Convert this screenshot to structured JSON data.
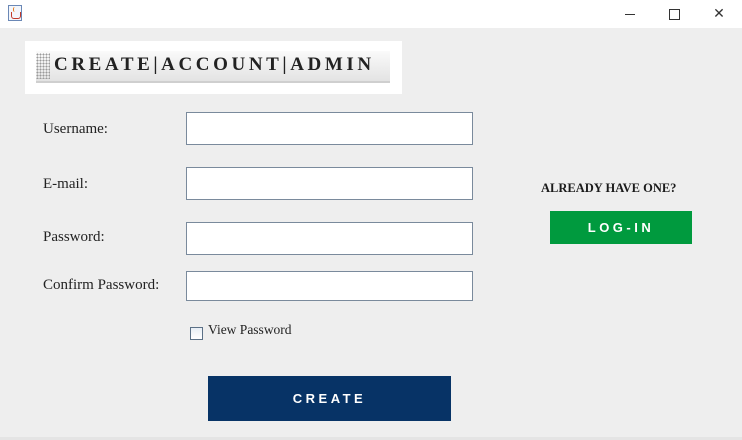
{
  "window": {
    "app_icon": "java-cup-icon",
    "controls": {
      "minimize_icon": "minimize-icon",
      "maximize_icon": "maximize-icon",
      "close_icon": "close-icon",
      "close_glyph": "✕"
    }
  },
  "header": {
    "title": "CREATE|ACCOUNT|ADMIN"
  },
  "form": {
    "username_label": "Username:",
    "username_value": "",
    "email_label": "E-mail:",
    "email_value": "",
    "password_label": "Password:",
    "password_value": "",
    "confirm_password_label": "Confirm Password:",
    "confirm_password_value": "",
    "view_password_label": "View Password",
    "view_password_checked": false,
    "create_button": "CREATE"
  },
  "side": {
    "prompt": "ALREADY HAVE ONE?",
    "login_button": "LOG-IN"
  },
  "colors": {
    "create_button_bg": "#073366",
    "login_button_bg": "#009a3e",
    "window_bg": "#eeeeee"
  }
}
